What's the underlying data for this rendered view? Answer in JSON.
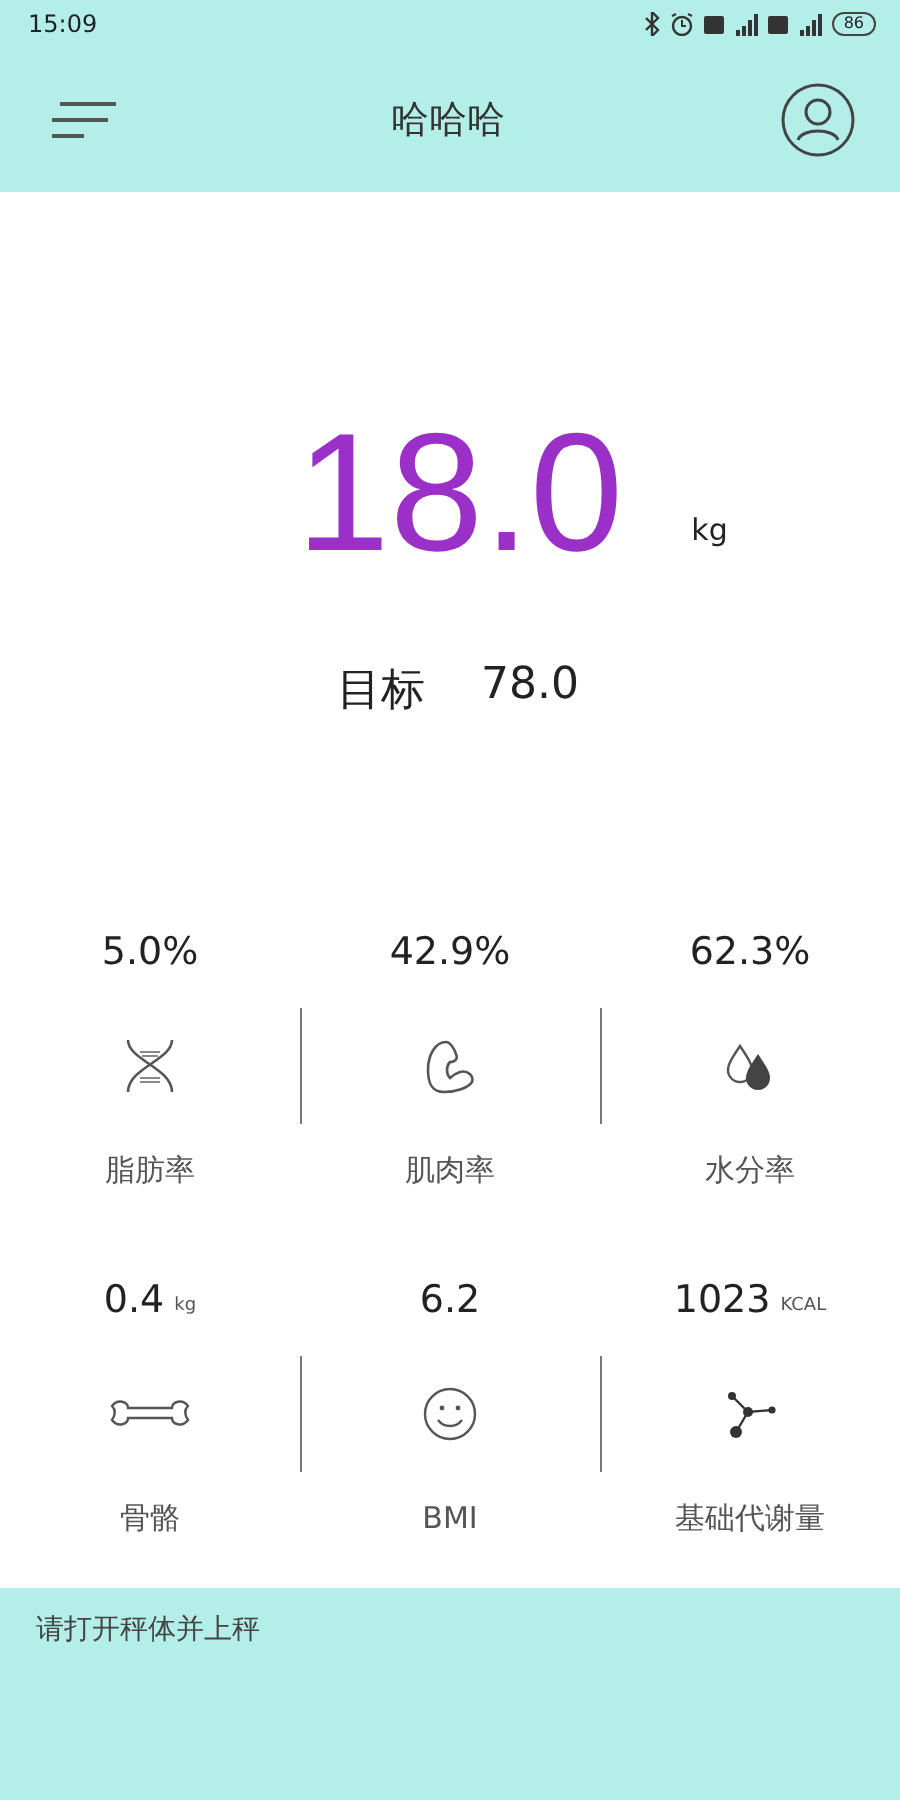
{
  "status_bar": {
    "time": "15:09",
    "battery": "86"
  },
  "header": {
    "title": "哈哈哈"
  },
  "weight": {
    "value": "18.0",
    "unit": "kg"
  },
  "target": {
    "label": "目标",
    "value": "78.0"
  },
  "metrics": [
    {
      "value": "5.0%",
      "label": "脂肪率",
      "kind": "dna"
    },
    {
      "value": "42.9%",
      "label": "肌肉率",
      "kind": "muscle"
    },
    {
      "value": "62.3%",
      "label": "水分率",
      "kind": "water"
    },
    {
      "value": "0.4",
      "unit": "kg",
      "label": "骨骼",
      "kind": "bone"
    },
    {
      "value": "6.2",
      "label": "BMI",
      "kind": "smile"
    },
    {
      "value": "1023",
      "unit": "KCAL",
      "label": "基础代谢量",
      "kind": "nodes"
    }
  ],
  "hint": "请打开秤体并上秤"
}
